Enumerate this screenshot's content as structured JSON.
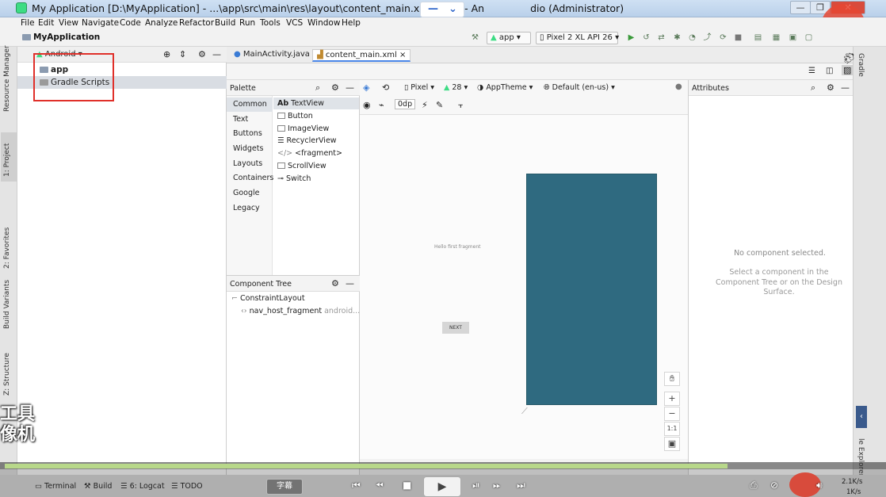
{
  "window": {
    "title": "My Application [D:\\MyApplication] - ...\\app\\src\\main\\res\\layout\\content_main.xml [app] - An",
    "title_suffix": "dio (Administrator)",
    "overlay_minus": "—",
    "overlay_chevron": "⌄",
    "min": "—",
    "max": "❐",
    "close": "✕"
  },
  "menu": [
    "File",
    "Edit",
    "View",
    "Navigate",
    "Code",
    "Analyze",
    "Refactor",
    "Build",
    "Run",
    "Tools",
    "VCS",
    "Window",
    "Help"
  ],
  "toolbar": {
    "breadcrumb": "MyApplication",
    "run_config": "app",
    "device": "Pixel 2 XL API 26"
  },
  "left_strip": {
    "resource_manager": "Resource Manager",
    "project": "1: Project",
    "favorites": "2: Favorites",
    "build_variants": "Build Variants",
    "structure": "Z: Structure"
  },
  "project_panel": {
    "view_mode": "Android",
    "items": [
      "app",
      "Gradle Scripts"
    ]
  },
  "editor_tabs": [
    "MainActivity.java",
    "content_main.xml"
  ],
  "palette": {
    "title": "Palette",
    "categories": [
      "Common",
      "Text",
      "Buttons",
      "Widgets",
      "Layouts",
      "Containers",
      "Google",
      "Legacy"
    ],
    "items": [
      "TextView",
      "Button",
      "ImageView",
      "RecyclerView",
      "<fragment>",
      "ScrollView",
      "Switch"
    ]
  },
  "design_toolbar": {
    "device": "Pixel",
    "api": "28",
    "theme": "AppTheme",
    "locale": "Default (en-us)",
    "margin": "0dp"
  },
  "component_tree": {
    "title": "Component Tree",
    "root": "ConstraintLayout",
    "child": "nav_host_fragment",
    "child_suffix": "android..."
  },
  "canvas": {
    "hello_text": "Hello first fragment",
    "next_button": "NEXT",
    "zoom_in": "+",
    "zoom_out": "−",
    "zoom_reset": "1:1"
  },
  "attributes": {
    "title": "Attributes",
    "empty_title": "No component selected.",
    "empty_hint": "Select a component in the Component Tree or on the Design Surface."
  },
  "right_strip": {
    "gradle": "Gradle",
    "file_explorer": "le Explorer"
  },
  "bottom_tools": [
    "Terminal",
    "Build",
    "6: Logcat",
    "TODO"
  ],
  "player": {
    "subtitle": "字幕",
    "speed_up": "2.1K/s",
    "speed_down": "1K/s"
  },
  "watermark": [
    "工具",
    "像机"
  ],
  "colors": {
    "blueprint": "#2f6a80",
    "highlight_box": "#e0302a",
    "progress": "#b8d88a"
  }
}
